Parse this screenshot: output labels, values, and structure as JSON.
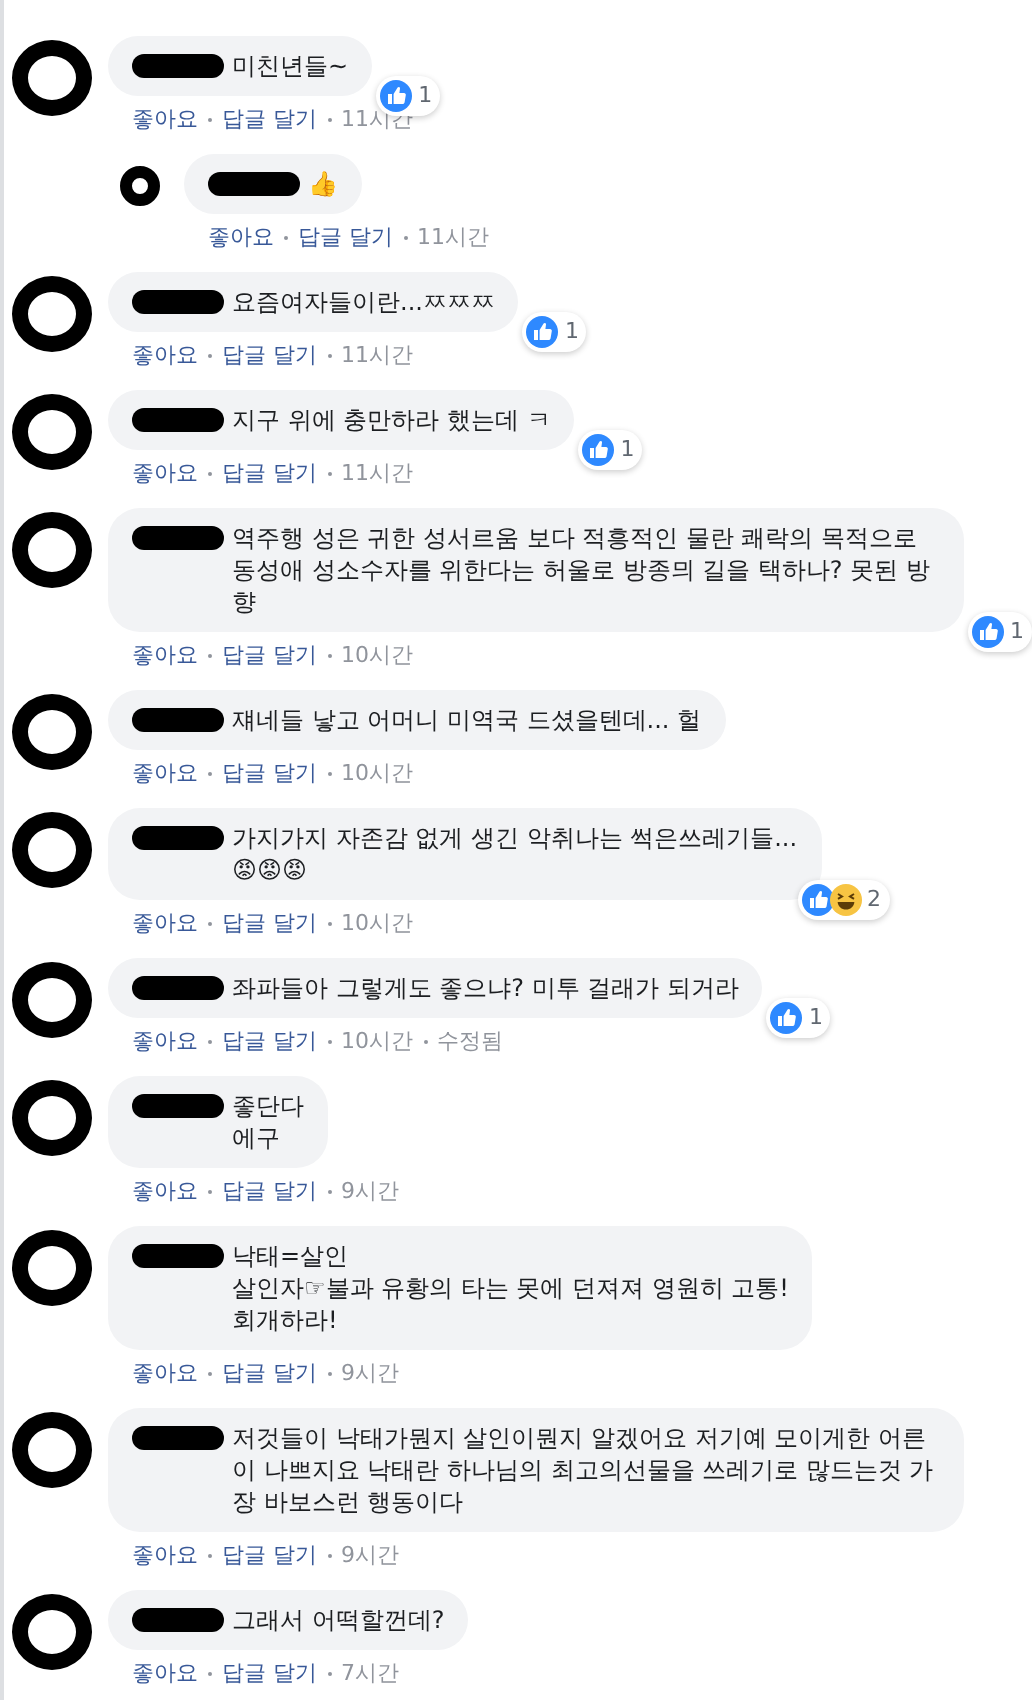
{
  "comments": [
    {
      "reply": false,
      "text": "미친년들~",
      "actions": [
        "좋아요",
        "답글 달기"
      ],
      "time": "11시간",
      "reactions": {
        "icons": [
          {
            "kind": "like"
          }
        ],
        "count": "1"
      }
    },
    {
      "reply": true,
      "text": "👍",
      "actions": [
        "좋아요",
        "답글 달기"
      ],
      "time": "11시간"
    },
    {
      "reply": false,
      "text": "요즘여자들이란...ㅉㅉㅉ",
      "actions": [
        "좋아요",
        "답글 달기"
      ],
      "time": "11시간",
      "reactions": {
        "icons": [
          {
            "kind": "like"
          }
        ],
        "count": "1"
      }
    },
    {
      "reply": false,
      "text": "지구 위에 충만하라 했는데 ㅋ",
      "actions": [
        "좋아요",
        "답글 달기"
      ],
      "time": "11시간",
      "reactions": {
        "icons": [
          {
            "kind": "like"
          }
        ],
        "count": "1"
      }
    },
    {
      "reply": false,
      "text": "역주행 성은 귀한 성서르움 보다 적흥적인 물란 쾌락의 목적으로 동성애 성소수자를 위한다는 허울로 방종믜 길을 택하나? 못된 방향",
      "actions": [
        "좋아요",
        "답글 달기"
      ],
      "time": "10시간",
      "reactions": {
        "icons": [
          {
            "kind": "like"
          }
        ],
        "count": "1"
      }
    },
    {
      "reply": false,
      "text": "쟤네들 낳고 어머니 미역국 드셨을텐데... 헐",
      "actions": [
        "좋아요",
        "답글 달기"
      ],
      "time": "10시간"
    },
    {
      "reply": false,
      "text": "가지가지 자존감 없게 생긴 악취나는 썩은쓰레기들...\n😡😡😡",
      "actions": [
        "좋아요",
        "답글 달기"
      ],
      "time": "10시간",
      "reactions": {
        "icons": [
          {
            "kind": "like"
          },
          {
            "kind": "haha"
          }
        ],
        "count": "2"
      }
    },
    {
      "reply": false,
      "text": "좌파들아 그렇게도 좋으냐? 미투 걸래가 되거라",
      "actions": [
        "좋아요",
        "답글 달기"
      ],
      "time": "10시간",
      "edited": "수정됨",
      "reactions": {
        "icons": [
          {
            "kind": "like"
          }
        ],
        "count": "1"
      }
    },
    {
      "reply": false,
      "text": "좋단다\n에구",
      "actions": [
        "좋아요",
        "답글 달기"
      ],
      "time": "9시간"
    },
    {
      "reply": false,
      "text": "낙태=살인\n살인자☞불과 유황의 타는 못에 던져져 영원히 고통!\n회개하라!",
      "actions": [
        "좋아요",
        "답글 달기"
      ],
      "time": "9시간"
    },
    {
      "reply": false,
      "text": "저것들이 낙태가뭔지 살인이뭔지 알겠어요 저기예 모이게한 어른이 나쁘지요 낙태란 하나님의 최고의선물을 쓰레기로 많드는것 가장 바보스런 행동이다",
      "actions": [
        "좋아요",
        "답글 달기"
      ],
      "time": "9시간"
    },
    {
      "reply": false,
      "text": "그래서 어떡할껀데?",
      "actions": [
        "좋아요",
        "답글 달기"
      ],
      "time": "7시간"
    }
  ]
}
